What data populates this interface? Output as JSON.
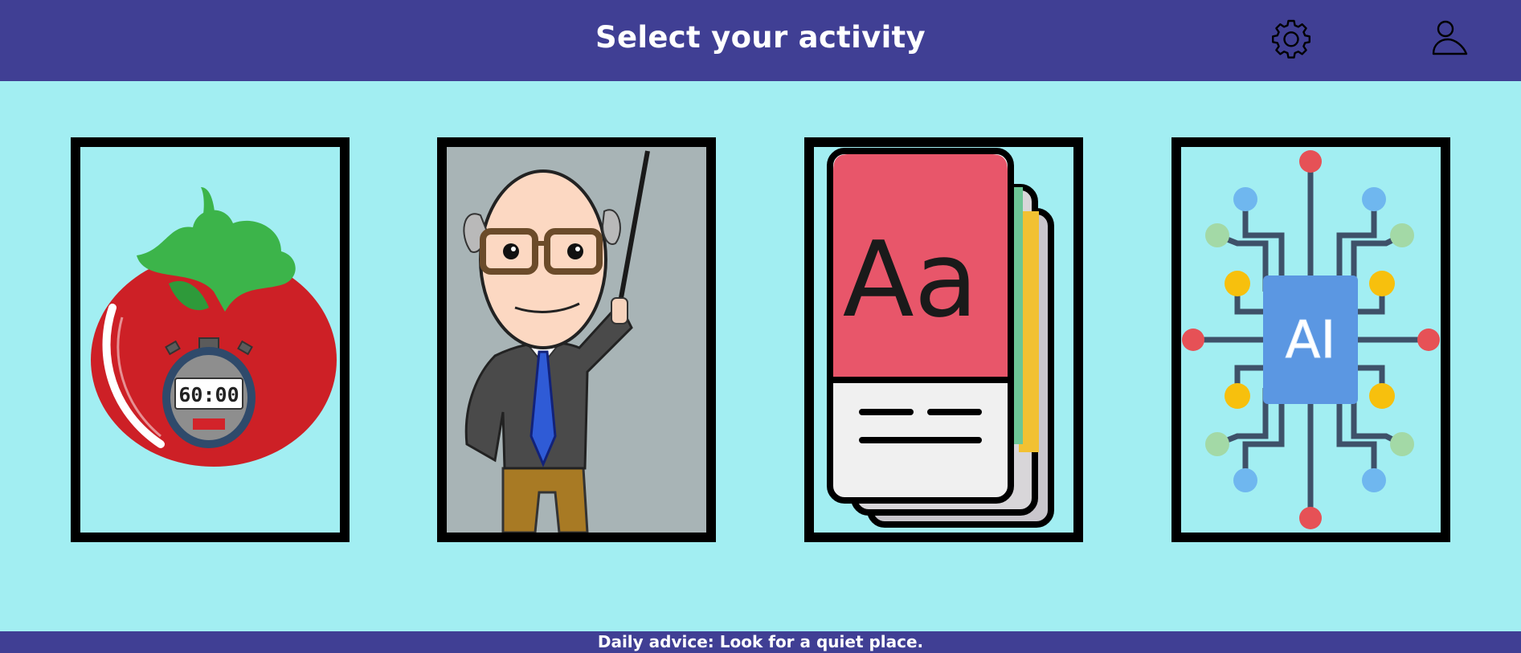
{
  "header": {
    "title": "Select your activity",
    "settings_icon": "gear-icon",
    "profile_icon": "user-icon"
  },
  "activities": [
    {
      "icon": "pomodoro-timer-tomato-icon",
      "timer_display": "60:00"
    },
    {
      "icon": "teacher-with-pointer-icon"
    },
    {
      "icon": "dictionary-book-icon",
      "book_label": "Aa"
    },
    {
      "icon": "ai-circuit-icon",
      "chip_label": "AI"
    }
  ],
  "footer": {
    "advice_prefix": "Daily advice:",
    "advice_text": "Look for a quiet place."
  },
  "colors": {
    "header_bg": "#403f94",
    "page_bg": "#a2eef2",
    "card_border": "#000000",
    "text": "#ffffff"
  }
}
